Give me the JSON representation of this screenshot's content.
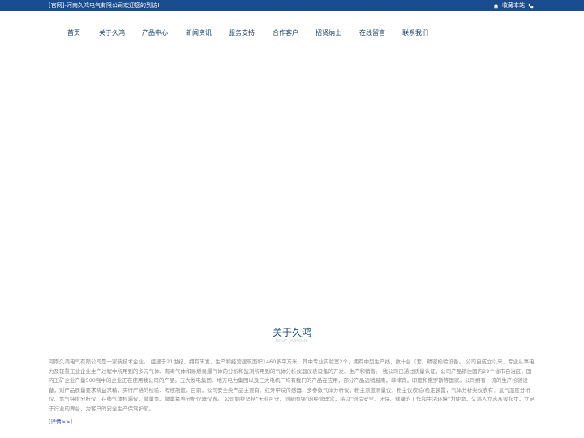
{
  "topbar": {
    "welcome": "[官网]-河南久鸿电气有限公司欢迎您的到访!",
    "favorite": "收藏本站",
    "home_icon": "home-icon",
    "phone_icon": "phone-icon"
  },
  "nav": {
    "items": [
      {
        "label": "首页"
      },
      {
        "label": "关于久鸿"
      },
      {
        "label": "产品中心"
      },
      {
        "label": "新闻资讯"
      },
      {
        "label": "服务支持"
      },
      {
        "label": "合作客户"
      },
      {
        "label": "招贤纳士"
      },
      {
        "label": "在线留言"
      },
      {
        "label": "联系我们"
      }
    ]
  },
  "about": {
    "title": "关于久鸿",
    "subtitle": "BOUT JIUHONG",
    "body": "河南久鸿电气有限公司是一家新技术企业。 组建于21世纪，拥有研发、生产和经营建筑面积1460多平方米，其中专业实验室2个，拥有中型生产线，数十台（套）精密检验设备。 公司自成立以来，专业从事电力及轻重工业企业生产过程中所用到的多元气体、有毒气体和易燃易爆气体的分析和监测所用到的气体分析仪器仪表设备的开发、生产和销售。 我公司已通过质量认证，公司产品销往国内29个省市自治区，国内工矿企业产量500强中的企业正在使用我公司的产品。五大发电集团、地方电力集团以及三大电机厂均有我们的产品在应用，部分产品远销越南，菲律宾，印度和俄罗斯等国家。公司拥有一流的生产检验设备，对产品质量要求精益求精，实行严格的检验、考核制度。目前，公司安全类产品主要有：红外甲烷传感器、多参数气体分析仪，粉尘浓度测量仪，粉尘仪校验/检定装置；气体分析类仪表有：氢气湿度分析仪、氢气纯度分析仪、在线气体检漏仪、微量氢、微量氧等分析仪器仪表。 公司始终坚持\"无业可守、创新图强\"的经营理念，将以\"创造安全、环保、健康的工作和生活环境\"为使命，久鸿人立志从零起步，立足于行业的舞台，为客户的安全生产保驾护航。",
    "details": "[详情>>]"
  },
  "colors": {
    "topbar_bg": "#1a4d8f",
    "nav_text": "#1a3f6e",
    "title": "#1a4d8f",
    "body_text": "#8a8a8a",
    "link": "#2233cc"
  }
}
